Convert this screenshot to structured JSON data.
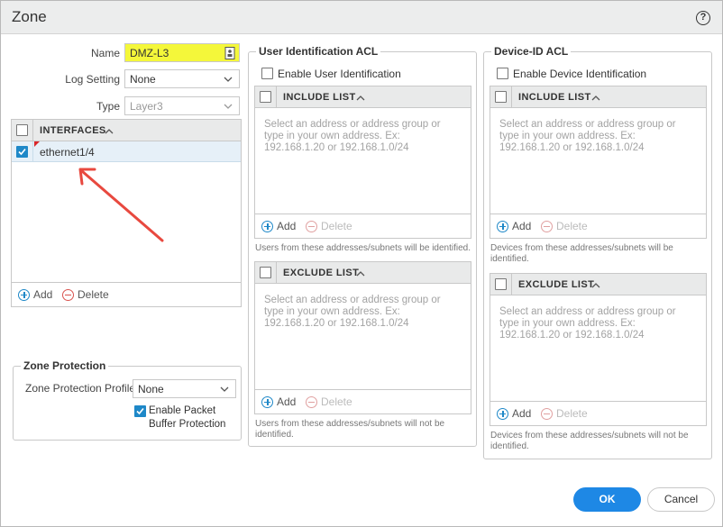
{
  "dialog": {
    "title": "Zone",
    "help_label": "?"
  },
  "general": {
    "name_label": "Name",
    "name_value": "DMZ-L3",
    "log_setting_label": "Log Setting",
    "log_setting_value": "None",
    "type_label": "Type",
    "type_value": "Layer3"
  },
  "interfaces": {
    "header": "INTERFACES",
    "rows": [
      {
        "name": "ethernet1/4",
        "checked": true
      }
    ],
    "add_label": "Add",
    "delete_label": "Delete"
  },
  "zone_protection": {
    "legend": "Zone Protection",
    "profile_label": "Zone Protection Profile",
    "profile_value": "None",
    "packet_buffer_label_line1": "Enable Packet",
    "packet_buffer_label_line2": "Buffer Protection",
    "packet_buffer_checked": true
  },
  "user_id_acl": {
    "legend": "User Identification ACL",
    "enable_label": "Enable User Identification",
    "include": {
      "header": "INCLUDE LIST",
      "placeholder": "Select an address or address group or type in your own address. Ex: 192.168.1.20 or 192.168.1.0/24",
      "add_label": "Add",
      "delete_label": "Delete",
      "note": "Users from these addresses/subnets will be identified."
    },
    "exclude": {
      "header": "EXCLUDE LIST",
      "placeholder": "Select an address or address group or type in your own address. Ex: 192.168.1.20 or 192.168.1.0/24",
      "add_label": "Add",
      "delete_label": "Delete",
      "note": "Users from these addresses/subnets will not be identified."
    }
  },
  "device_id_acl": {
    "legend": "Device-ID ACL",
    "enable_label": "Enable Device Identification",
    "include": {
      "header": "INCLUDE LIST",
      "placeholder": "Select an address or address group or type in your own address. Ex: 192.168.1.20 or 192.168.1.0/24",
      "add_label": "Add",
      "delete_label": "Delete",
      "note": "Devices from these addresses/subnets will be identified."
    },
    "exclude": {
      "header": "EXCLUDE LIST",
      "placeholder": "Select an address or address group or type in your own address. Ex: 192.168.1.20 or 192.168.1.0/24",
      "add_label": "Add",
      "delete_label": "Delete",
      "note": "Devices from these addresses/subnets will not be identified."
    }
  },
  "buttons": {
    "ok_label": "OK",
    "cancel_label": "Cancel"
  },
  "colors": {
    "accent": "#1e88e5",
    "name_highlight": "#f4f73a",
    "annotation_arrow": "#e8493f",
    "delete_active": "#d9534f"
  },
  "annotation": {
    "arrow_icon": "red-arrow-pointing-to-interface"
  }
}
